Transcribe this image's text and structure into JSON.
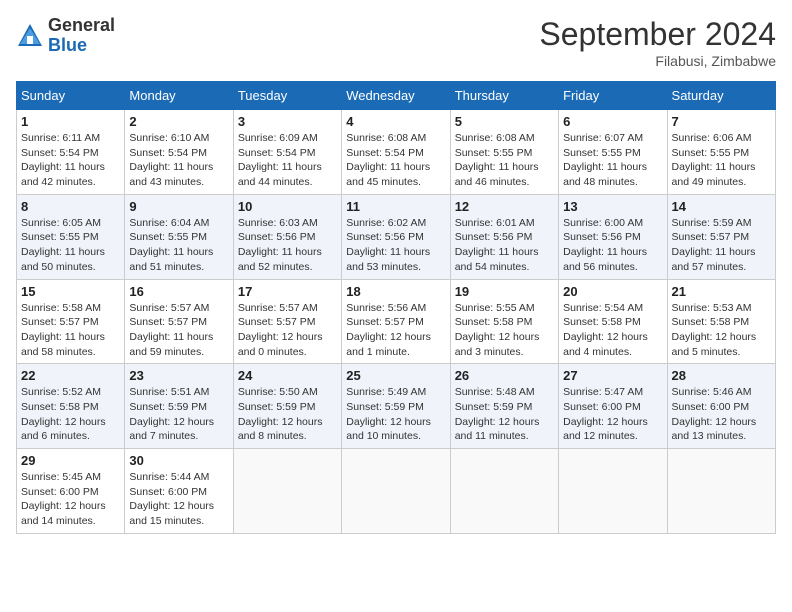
{
  "header": {
    "title": "September 2024",
    "location": "Filabusi, Zimbabwe",
    "logo_general": "General",
    "logo_blue": "Blue"
  },
  "columns": [
    "Sunday",
    "Monday",
    "Tuesday",
    "Wednesday",
    "Thursday",
    "Friday",
    "Saturday"
  ],
  "weeks": [
    [
      {
        "day": "1",
        "info": "Sunrise: 6:11 AM\nSunset: 5:54 PM\nDaylight: 11 hours and 42 minutes."
      },
      {
        "day": "2",
        "info": "Sunrise: 6:10 AM\nSunset: 5:54 PM\nDaylight: 11 hours and 43 minutes."
      },
      {
        "day": "3",
        "info": "Sunrise: 6:09 AM\nSunset: 5:54 PM\nDaylight: 11 hours and 44 minutes."
      },
      {
        "day": "4",
        "info": "Sunrise: 6:08 AM\nSunset: 5:54 PM\nDaylight: 11 hours and 45 minutes."
      },
      {
        "day": "5",
        "info": "Sunrise: 6:08 AM\nSunset: 5:55 PM\nDaylight: 11 hours and 46 minutes."
      },
      {
        "day": "6",
        "info": "Sunrise: 6:07 AM\nSunset: 5:55 PM\nDaylight: 11 hours and 48 minutes."
      },
      {
        "day": "7",
        "info": "Sunrise: 6:06 AM\nSunset: 5:55 PM\nDaylight: 11 hours and 49 minutes."
      }
    ],
    [
      {
        "day": "8",
        "info": "Sunrise: 6:05 AM\nSunset: 5:55 PM\nDaylight: 11 hours and 50 minutes."
      },
      {
        "day": "9",
        "info": "Sunrise: 6:04 AM\nSunset: 5:55 PM\nDaylight: 11 hours and 51 minutes."
      },
      {
        "day": "10",
        "info": "Sunrise: 6:03 AM\nSunset: 5:56 PM\nDaylight: 11 hours and 52 minutes."
      },
      {
        "day": "11",
        "info": "Sunrise: 6:02 AM\nSunset: 5:56 PM\nDaylight: 11 hours and 53 minutes."
      },
      {
        "day": "12",
        "info": "Sunrise: 6:01 AM\nSunset: 5:56 PM\nDaylight: 11 hours and 54 minutes."
      },
      {
        "day": "13",
        "info": "Sunrise: 6:00 AM\nSunset: 5:56 PM\nDaylight: 11 hours and 56 minutes."
      },
      {
        "day": "14",
        "info": "Sunrise: 5:59 AM\nSunset: 5:57 PM\nDaylight: 11 hours and 57 minutes."
      }
    ],
    [
      {
        "day": "15",
        "info": "Sunrise: 5:58 AM\nSunset: 5:57 PM\nDaylight: 11 hours and 58 minutes."
      },
      {
        "day": "16",
        "info": "Sunrise: 5:57 AM\nSunset: 5:57 PM\nDaylight: 11 hours and 59 minutes."
      },
      {
        "day": "17",
        "info": "Sunrise: 5:57 AM\nSunset: 5:57 PM\nDaylight: 12 hours and 0 minutes."
      },
      {
        "day": "18",
        "info": "Sunrise: 5:56 AM\nSunset: 5:57 PM\nDaylight: 12 hours and 1 minute."
      },
      {
        "day": "19",
        "info": "Sunrise: 5:55 AM\nSunset: 5:58 PM\nDaylight: 12 hours and 3 minutes."
      },
      {
        "day": "20",
        "info": "Sunrise: 5:54 AM\nSunset: 5:58 PM\nDaylight: 12 hours and 4 minutes."
      },
      {
        "day": "21",
        "info": "Sunrise: 5:53 AM\nSunset: 5:58 PM\nDaylight: 12 hours and 5 minutes."
      }
    ],
    [
      {
        "day": "22",
        "info": "Sunrise: 5:52 AM\nSunset: 5:58 PM\nDaylight: 12 hours and 6 minutes."
      },
      {
        "day": "23",
        "info": "Sunrise: 5:51 AM\nSunset: 5:59 PM\nDaylight: 12 hours and 7 minutes."
      },
      {
        "day": "24",
        "info": "Sunrise: 5:50 AM\nSunset: 5:59 PM\nDaylight: 12 hours and 8 minutes."
      },
      {
        "day": "25",
        "info": "Sunrise: 5:49 AM\nSunset: 5:59 PM\nDaylight: 12 hours and 10 minutes."
      },
      {
        "day": "26",
        "info": "Sunrise: 5:48 AM\nSunset: 5:59 PM\nDaylight: 12 hours and 11 minutes."
      },
      {
        "day": "27",
        "info": "Sunrise: 5:47 AM\nSunset: 6:00 PM\nDaylight: 12 hours and 12 minutes."
      },
      {
        "day": "28",
        "info": "Sunrise: 5:46 AM\nSunset: 6:00 PM\nDaylight: 12 hours and 13 minutes."
      }
    ],
    [
      {
        "day": "29",
        "info": "Sunrise: 5:45 AM\nSunset: 6:00 PM\nDaylight: 12 hours and 14 minutes."
      },
      {
        "day": "30",
        "info": "Sunrise: 5:44 AM\nSunset: 6:00 PM\nDaylight: 12 hours and 15 minutes."
      },
      null,
      null,
      null,
      null,
      null
    ]
  ]
}
